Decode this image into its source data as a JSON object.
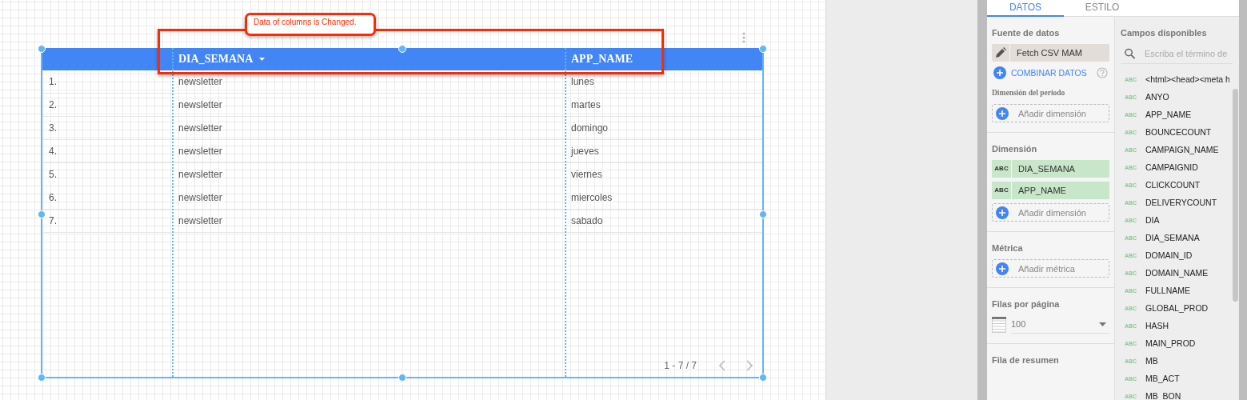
{
  "annotation": {
    "text": "Data of columns is Changed."
  },
  "table": {
    "columns": [
      {
        "label": "DIA_SEMANA",
        "sorted": true
      },
      {
        "label": "APP_NAME",
        "sorted": false
      }
    ],
    "rows": [
      {
        "index": "1.",
        "cells": [
          "newsletter",
          "lunes"
        ]
      },
      {
        "index": "2.",
        "cells": [
          "newsletter",
          "martes"
        ]
      },
      {
        "index": "3.",
        "cells": [
          "newsletter",
          "domingo"
        ]
      },
      {
        "index": "4.",
        "cells": [
          "newsletter",
          "jueves"
        ]
      },
      {
        "index": "5.",
        "cells": [
          "newsletter",
          "viernes"
        ]
      },
      {
        "index": "6.",
        "cells": [
          "newsletter",
          "miercoles"
        ]
      },
      {
        "index": "7.",
        "cells": [
          "newsletter",
          "sabado"
        ]
      }
    ],
    "pagination": "1 - 7 / 7"
  },
  "panel": {
    "tabs": [
      {
        "label": "DATOS",
        "selected": true
      },
      {
        "label": "ESTILO",
        "selected": false
      }
    ],
    "data_source": {
      "heading": "Fuente de datos",
      "name": "Fetch CSV MAM",
      "blend_link": "COMBINAR DATOS"
    },
    "date_dimension": {
      "heading": "Dimensión del periodo",
      "add_label": "Añadir dimensión"
    },
    "dimension": {
      "heading": "Dimensión",
      "fields": [
        {
          "type": "ABC",
          "name": "DIA_SEMANA"
        },
        {
          "type": "ABC",
          "name": "APP_NAME"
        }
      ],
      "add_label": "Añadir dimensión"
    },
    "metric": {
      "heading": "Métrica",
      "add_label": "Añadir métrica"
    },
    "rows_per_page": {
      "heading": "Filas por página",
      "value": "100"
    },
    "summary_row": {
      "heading": "Fila de resumen"
    },
    "available_fields": {
      "heading": "Campos disponibles",
      "placeholder": "Escriba el término de",
      "fields": [
        {
          "type": "ABC",
          "name": "<html><head><meta h"
        },
        {
          "type": "ABC",
          "name": "ANYO"
        },
        {
          "type": "ABC",
          "name": "APP_NAME"
        },
        {
          "type": "ABC",
          "name": "BOUNCECOUNT"
        },
        {
          "type": "ABC",
          "name": "CAMPAIGN_NAME"
        },
        {
          "type": "ABC",
          "name": "CAMPAIGNID"
        },
        {
          "type": "ABC",
          "name": "CLICKCOUNT"
        },
        {
          "type": "ABC",
          "name": "DELIVERYCOUNT"
        },
        {
          "type": "ABC",
          "name": "DIA"
        },
        {
          "type": "ABC",
          "name": "DIA_SEMANA"
        },
        {
          "type": "ABC",
          "name": "DOMAIN_ID"
        },
        {
          "type": "ABC",
          "name": "DOMAIN_NAME"
        },
        {
          "type": "ABC",
          "name": "FULLNAME"
        },
        {
          "type": "ABC",
          "name": "GLOBAL_PROD"
        },
        {
          "type": "ABC",
          "name": "HASH"
        },
        {
          "type": "ABC",
          "name": "MAIN_PROD"
        },
        {
          "type": "ABC",
          "name": "MB"
        },
        {
          "type": "ABC",
          "name": "MB_ACT"
        },
        {
          "type": "ABC",
          "name": "MB_BON"
        }
      ]
    }
  }
}
